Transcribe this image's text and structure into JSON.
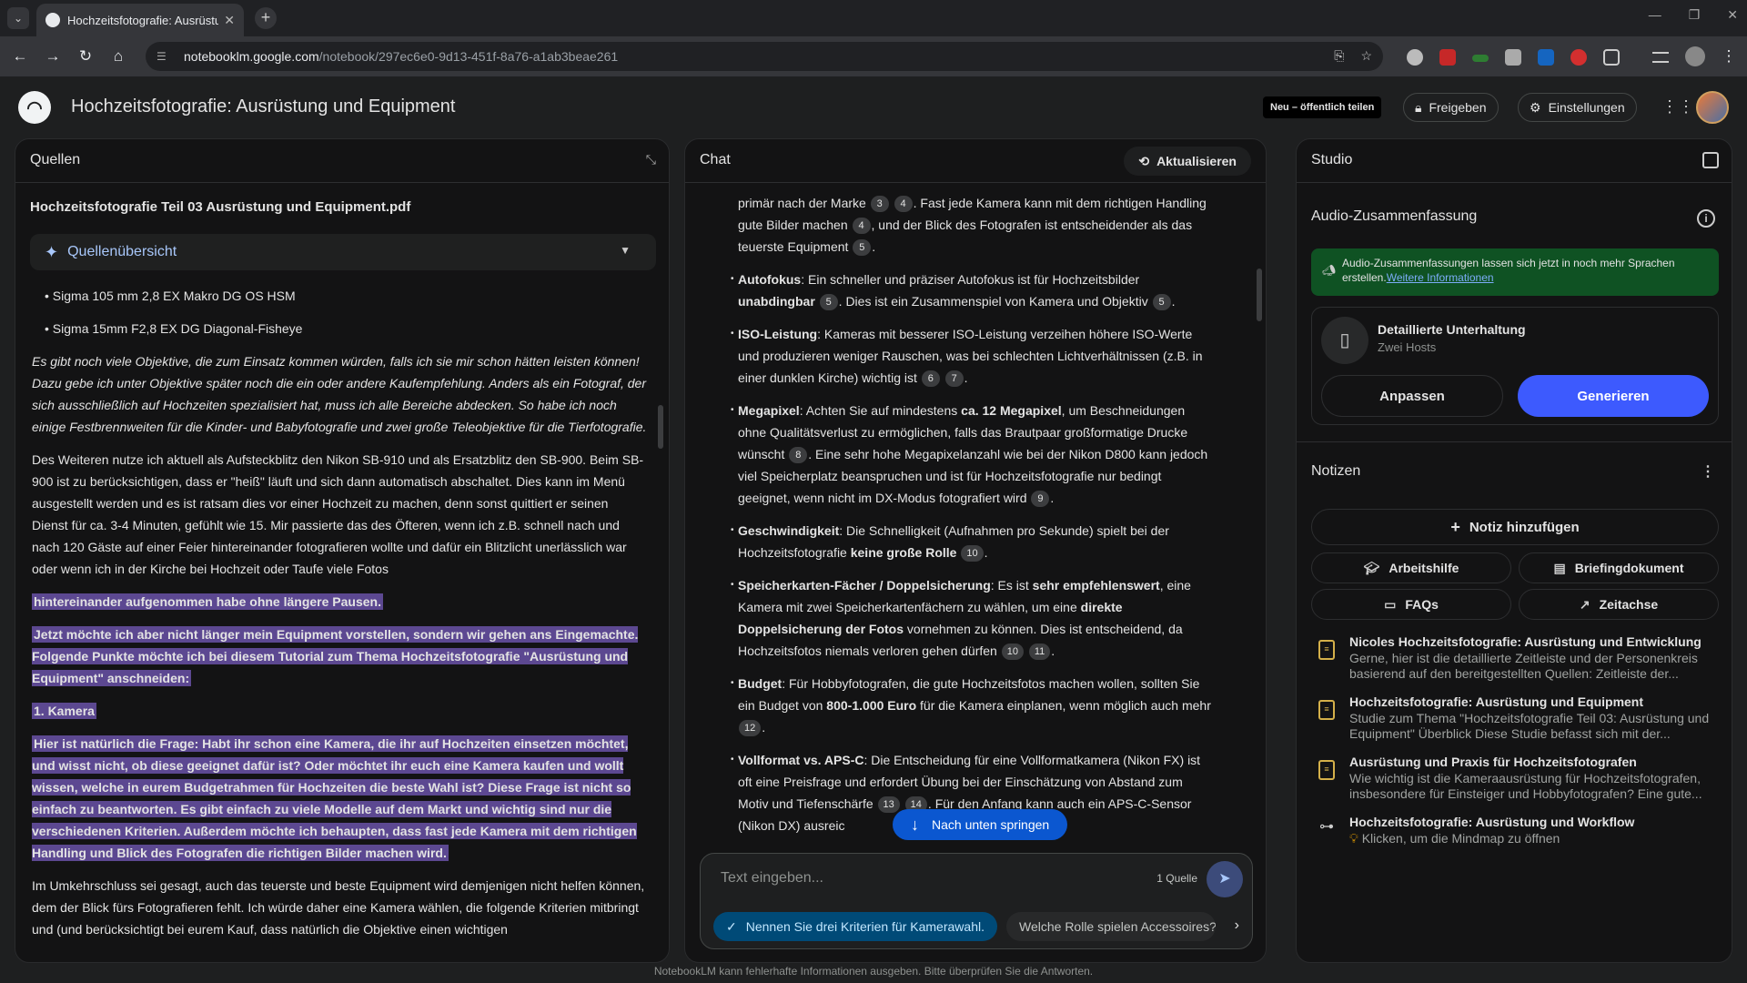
{
  "browser": {
    "tab_title": "Hochzeitsfotografie: Ausrüstung",
    "url_host": "notebooklm.google.com",
    "url_path": "/notebook/297ec6e0-9d13-451f-8a76-a1ab3beae261"
  },
  "header": {
    "title": "Hochzeitsfotografie: Ausrüstung und Equipment",
    "new_share": "Neu – öffentlich teilen",
    "share": "Freigeben",
    "settings": "Einstellungen"
  },
  "sources": {
    "title": "Quellen",
    "file_name": "Hochzeitsfotografie Teil 03 Ausrüstung und Equipment.pdf",
    "overview": "Quellenübersicht",
    "bullets": [
      "Sigma 105 mm 2,8 EX Makro DG OS HSM",
      "Sigma 15mm F2,8 EX DG Diagonal-Fisheye"
    ],
    "italic_para": "Es gibt noch viele Objektive, die zum Einsatz kommen würden, falls ich sie mir schon hätten leisten können! Dazu gebe ich unter Objektive später noch die ein oder andere Kaufempfehlung. Anders als ein Fotograf, der sich ausschließlich auf Hochzeiten spezialisiert hat, muss ich alle Bereiche abdecken. So habe ich noch einige Festbrennweiten für die Kinder- und Babyfotografie und zwei große Teleobjektive für die Tierfotografie.",
    "para1": "Des Weiteren nutze ich aktuell als Aufsteckblitz den Nikon SB-910 und als Ersatzblitz den SB-900. Beim SB-900 ist zu berücksichtigen, dass er \"heiß\" läuft und sich dann automatisch abschaltet. Dies kann im Menü ausgestellt werden und es ist ratsam dies vor einer Hochzeit zu machen, denn sonst quittiert er seinen Dienst für ca. 3-4 Minuten, gefühlt wie 15. Mir passierte das des Öfteren, wenn ich z.B. schnell nach und nach 120 Gäste auf einer Feier hintereinander fotografieren wollte und dafür ein Blitzlicht unerlässlich war oder wenn ich in der Kirche bei Hochzeit oder Taufe viele Fotos",
    "hl1": "hintereinander aufgenommen habe ohne längere Pausen.",
    "hl2": "Jetzt möchte ich aber nicht länger mein Equipment vorstellen, sondern wir gehen ans Eingemachte. Folgende Punkte möchte ich bei diesem Tutorial zum Thema Hochzeitsfotografie \"Ausrüstung und Equipment\" anschneiden:",
    "hl3": "1. Kamera",
    "hl4": "Hier ist natürlich die Frage: Habt ihr schon eine Kamera, die ihr auf Hochzeiten einsetzen möchtet, und wisst nicht, ob diese geeignet dafür ist? Oder möchtet ihr euch eine Kamera kaufen und wollt wissen, welche in eurem Budgetrahmen für Hochzeiten die beste Wahl ist? Diese Frage ist nicht so einfach zu beantworten. Es gibt einfach zu viele Modelle auf dem Markt und wichtig sind nur die verschiedenen Kriterien. Außerdem möchte ich behaupten, dass fast jede Kamera mit dem richtigen Handling und Blick des Fotografen die richtigen Bilder machen wird.",
    "para2": "Im Umkehrschluss sei gesagt, auch das teuerste und beste Equipment wird demjenigen nicht helfen können, dem der Blick fürs Fotografieren fehlt. Ich würde daher eine Kamera wählen, die folgende Kriterien mitbringt und (und berücksichtigt bei eurem Kauf, dass natürlich die Objektive einen wichtigen"
  },
  "chat": {
    "title": "Chat",
    "refresh": "Aktualisieren",
    "intro": {
      "t1": "primär nach der Marke",
      "c1": "3",
      "c2": "4",
      "t2": ". Fast jede Kamera kann mit dem richtigen Handling gute Bilder machen",
      "c3": "4",
      "t3": ", und der Blick des Fotografen ist entscheidender als das teuerste Equipment",
      "c4": "5",
      "t4": "."
    },
    "autofokus": {
      "label": "Autofokus",
      "t1": ": Ein schneller und präziser Autofokus ist für Hochzeitsbilder ",
      "b1": "unabdingbar",
      "c1": "5",
      "t2": ". Dies ist ein Zusammenspiel von Kamera und Objektiv",
      "c2": "5",
      "t3": "."
    },
    "iso": {
      "label": "ISO-Leistung",
      "t1": ": Kameras mit besserer ISO-Leistung verzeihen höhere ISO-Werte und produzieren weniger Rauschen, was bei schlechten Lichtverhältnissen (z.B. in einer dunklen Kirche) wichtig ist",
      "c1": "6",
      "c2": "7",
      "t2": "."
    },
    "megapixel": {
      "label": "Megapixel",
      "t1": ": Achten Sie auf mindestens ",
      "b1": "ca. 12 Megapixel",
      "t2": ", um Beschneidungen ohne Qualitätsverlust zu ermöglichen, falls das Brautpaar großformatige Drucke wünscht",
      "c1": "8",
      "t3": ". Eine sehr hohe Megapixelanzahl wie bei der Nikon D800 kann jedoch viel Speicherplatz beanspruchen und ist für Hochzeitsfotografie nur bedingt geeignet, wenn nicht im DX-Modus fotografiert wird",
      "c2": "9",
      "t4": "."
    },
    "speed": {
      "label": "Geschwindigkeit",
      "t1": ": Die Schnelligkeit (Aufnahmen pro Sekunde) spielt bei der Hochzeitsfotografie ",
      "b1": "keine große Rolle",
      "c1": "10",
      "t2": "."
    },
    "cards": {
      "label": "Speicherkarten-Fächer / Doppelsicherung",
      "t1": ": Es ist ",
      "b1": "sehr empfehlenswert",
      "t2": ", eine Kamera mit zwei Speicherkartenfächern zu wählen, um eine ",
      "b2": "direkte Doppelsicherung der Fotos",
      "t3": " vornehmen zu können. Dies ist entscheidend, da Hochzeitsfotos niemals verloren gehen dürfen",
      "c1": "10",
      "c2": "11",
      "t4": "."
    },
    "budget": {
      "label": "Budget",
      "t1": ": Für Hobbyfotografen, die gute Hochzeitsfotos machen wollen, sollten Sie ein Budget von ",
      "b1": "800-1.000 Euro",
      "t2": " für die Kamera einplanen, wenn möglich auch mehr",
      "c1": "12",
      "t3": "."
    },
    "vollformat": {
      "label": "Vollformat vs. APS-C",
      "t1": ": Die Entscheidung für eine Vollformatkamera (Nikon FX) ist oft eine Preisfrage und erfordert Übung bei der Einschätzung von Abstand zum Motiv und Tiefenschärfe",
      "c1": "13",
      "c2": "14",
      "t2": ". Für den Anfang kann auch ein APS-C-Sensor (Nikon DX) ausreic"
    },
    "jump": "Nach unten springen",
    "input_placeholder": "Text eingeben...",
    "source_count": "1 Quelle",
    "suggestion1": "Nennen Sie drei Kriterien für Kamerawahl.",
    "suggestion2": "Welche Rolle spielen Accessoires?"
  },
  "studio": {
    "title": "Studio",
    "audio_title": "Audio-Zusammenfassung",
    "banner_text": "Audio-Zusammenfassungen lassen sich jetzt in noch mehr Sprachen erstellen.",
    "banner_link": "Weitere Informationen",
    "card_title": "Detaillierte Unterhaltung",
    "card_sub": "Zwei Hosts",
    "adjust": "Anpassen",
    "generate": "Generieren",
    "notes_title": "Notizen",
    "add_note": "Notiz hinzufügen",
    "btn_study": "Arbeitshilfe",
    "btn_brief": "Briefingdokument",
    "btn_faq": "FAQs",
    "btn_timeline": "Zeitachse",
    "notes": [
      {
        "title": "Nicoles Hochzeitsfotografie: Ausrüstung und Entwicklung",
        "text": "Gerne, hier ist die detaillierte Zeitleiste und der Personenkreis basierend auf den bereitgestellten Quellen: Zeitleiste der..."
      },
      {
        "title": "Hochzeitsfotografie: Ausrüstung und Equipment",
        "text": "Studie zum Thema \"Hochzeitsfotografie Teil 03: Ausrüstung und Equipment\" Überblick Diese Studie befasst sich mit der..."
      },
      {
        "title": "Ausrüstung und Praxis für Hochzeitsfotografen",
        "text": "Wie wichtig ist die Kameraausrüstung für Hochzeitsfotografen, insbesondere für Einsteiger und Hobbyfotografen? Eine gute..."
      },
      {
        "title": "Hochzeitsfotografie: Ausrüstung und Workflow",
        "text": "Klicken, um die Mindmap zu öffnen"
      }
    ]
  },
  "footer": "NotebookLM kann fehlerhafte Informationen ausgeben. Bitte überprüfen Sie die Antworten."
}
